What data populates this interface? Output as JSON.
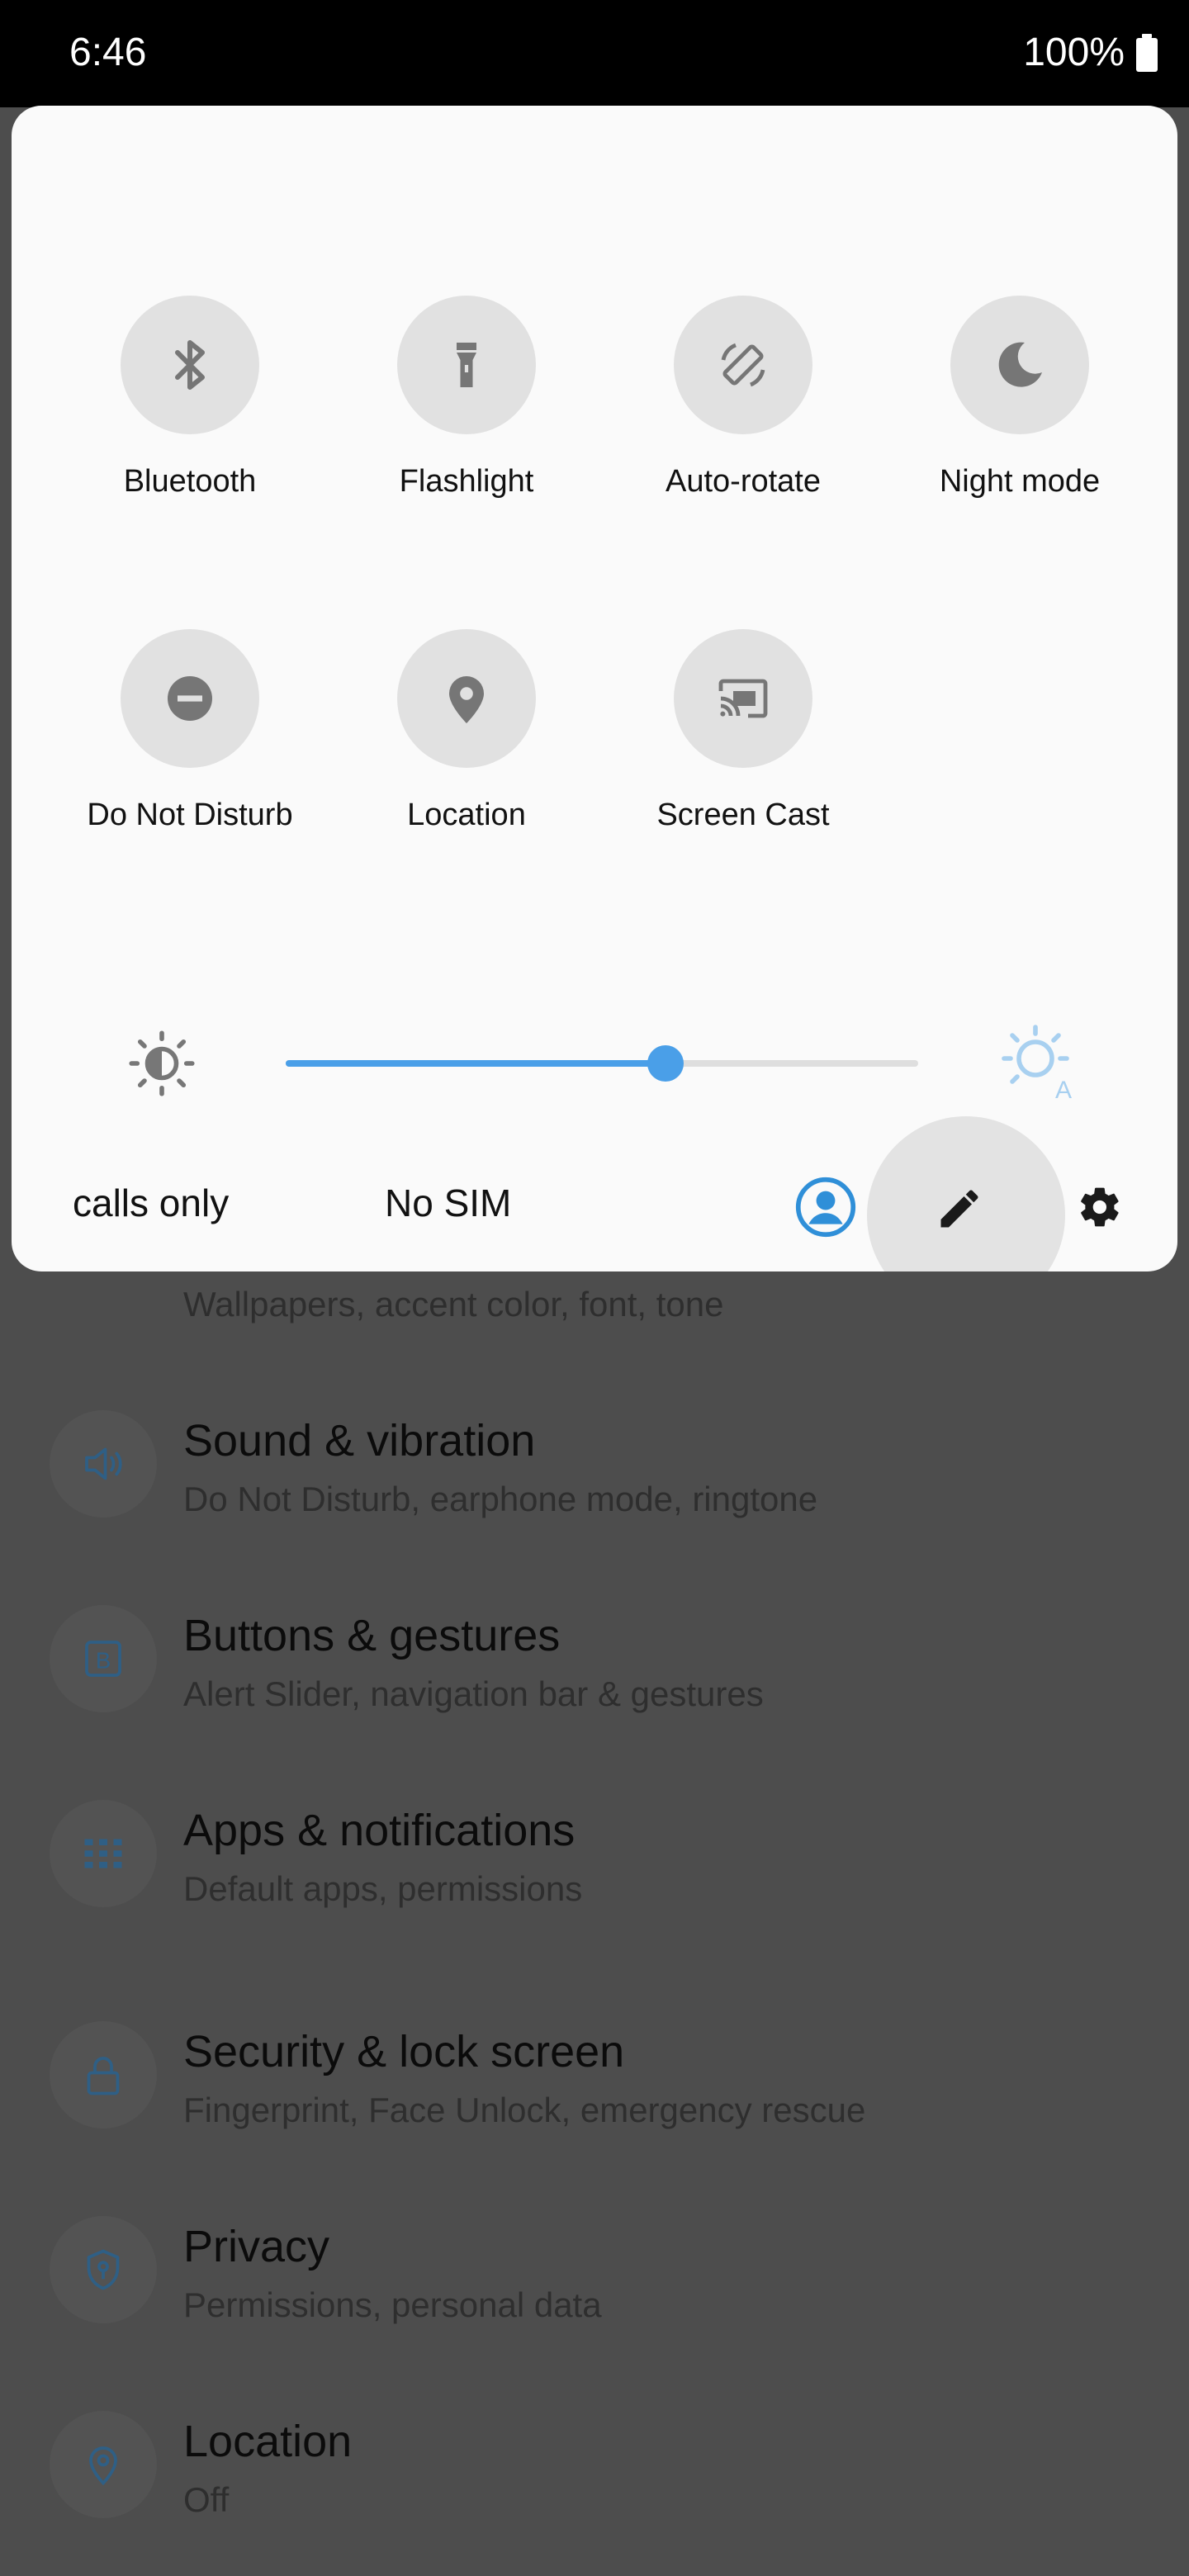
{
  "status_bar": {
    "time": "6:46",
    "battery": "100%"
  },
  "quick_settings": {
    "tiles": [
      {
        "label": "Bluetooth",
        "icon": "bluetooth-icon"
      },
      {
        "label": "Flashlight",
        "icon": "flashlight-icon"
      },
      {
        "label": "Auto-rotate",
        "icon": "auto-rotate-icon"
      },
      {
        "label": "Night mode",
        "icon": "night-mode-icon"
      },
      {
        "label": "Do Not Disturb",
        "icon": "do-not-disturb-icon"
      },
      {
        "label": "Location",
        "icon": "location-icon"
      },
      {
        "label": "Screen Cast",
        "icon": "screen-cast-icon"
      }
    ],
    "brightness": {
      "level": 0.6
    },
    "footer": {
      "carrier_1": "calls only",
      "carrier_2": "No SIM"
    }
  },
  "settings_list": [
    {
      "title": "",
      "subtitle": "Wallpapers, accent color, font, tone",
      "icon": "display-icon"
    },
    {
      "title": "Sound & vibration",
      "subtitle": "Do Not Disturb, earphone mode, ringtone",
      "icon": "speaker-icon"
    },
    {
      "title": "Buttons & gestures",
      "subtitle": "Alert Slider, navigation bar & gestures",
      "icon": "button-b-icon"
    },
    {
      "title": "Apps & notifications",
      "subtitle": "Default apps, permissions",
      "icon": "apps-grid-icon"
    },
    {
      "title": "Security & lock screen",
      "subtitle": "Fingerprint, Face Unlock, emergency rescue",
      "icon": "lock-icon"
    },
    {
      "title": "Privacy",
      "subtitle": "Permissions, personal data",
      "icon": "privacy-shield-icon"
    },
    {
      "title": "Location",
      "subtitle": "Off",
      "icon": "location-pin-icon"
    }
  ],
  "colors": {
    "accent": "#4a9fe8",
    "tile_bg": "#e1e1e1",
    "panel_bg": "#fafafa",
    "scrim": "#4d4d4d"
  }
}
